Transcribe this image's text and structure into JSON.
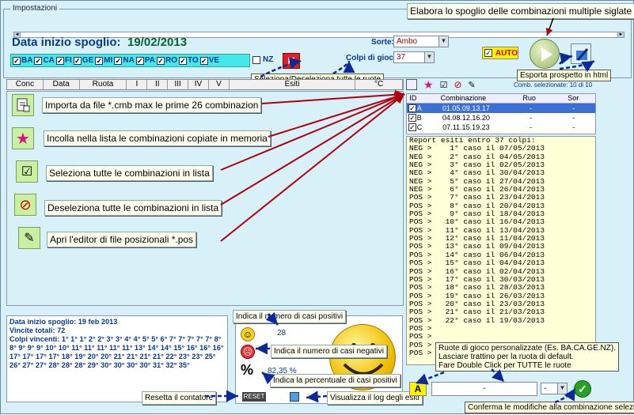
{
  "header": {
    "group_title": "Impostazioni",
    "start_label": "Data inizio spoglio:",
    "start_date": "19/02/2013",
    "sorte_label": "Sorte:",
    "sorte_value": "Ambo",
    "colpi_label": "Colpi di gioco:",
    "colpi_value": "37",
    "auto_label": "AUTO",
    "nz_label": "NZ",
    "n_button": "N"
  },
  "wheels": [
    "BA",
    "CA",
    "FI",
    "GE",
    "MI",
    "NA",
    "PA",
    "RO",
    "TO",
    "VE"
  ],
  "columns": [
    "Conc",
    "Data",
    "Ruota",
    "I",
    "II",
    "III",
    "IV",
    "V",
    "Esiti",
    "°C"
  ],
  "combo_table": {
    "headers": [
      "ID",
      "Combinazione",
      "Ruo",
      "Sor"
    ],
    "count_label": "Comb. selezionate: 10 di 10",
    "rows": [
      {
        "id": "A",
        "combo": "01.05.09.13.17",
        "ruo": "-",
        "sor": "-"
      },
      {
        "id": "B",
        "combo": "04.08.12.16.20",
        "ruo": "-",
        "sor": "-"
      },
      {
        "id": "C",
        "combo": "07.11.15.19.23",
        "ruo": "-",
        "sor": "-"
      }
    ]
  },
  "report": {
    "title": "Report esiti entro 37 colpi:",
    "lines": [
      "NEG >    1° caso il 07/05/2013",
      "NEG >    2° caso il 04/05/2013",
      "NEG >    3° caso il 02/05/2013",
      "NEG >    4° caso il 30/04/2013",
      "NEG >    5° caso il 27/04/2013",
      "NEG >    6° caso il 26/04/2013",
      "POS >    7° caso il 23/04/2013",
      "POS >    8° caso il 20/04/2013",
      "POS >    9° caso il 18/04/2013",
      "POS >   10° caso il 16/04/2013",
      "POS >   11° caso il 13/04/2013",
      "POS >   12° caso il 11/04/2013",
      "POS >   13° caso il 09/04/2013",
      "POS >   14° caso il 06/04/2013",
      "POS >   15° caso il 04/04/2013",
      "POS >   16° caso il 02/04/2013",
      "POS >   17° caso il 30/03/2013",
      "POS >   18° caso il 28/03/2013",
      "POS >   19° caso il 26/03/2013",
      "POS >   20° caso il 23/03/2013",
      "POS >   21° caso il 21/03/2013",
      "POS >   22° caso il 19/03/2013",
      "POS >",
      "POS >",
      "POS >",
      "POS >"
    ]
  },
  "stats": {
    "line1": "Data inizio spoglio: 19 feb 2013",
    "line2": "Vincite totali: 72",
    "line3": "Colpi vincenti: 1° 1° 1° 2° 2° 3° 3° 4° 4° 5° 5° 6° 7° 7° 7° 7° 7° 8° 8° 9° 9° 9° 10° 10° 11° 11° 11° 11° 11° 13° 14° 14° 15° 16° 16° 16° 17° 17° 17° 17° 18° 19° 20° 20° 21° 21° 21° 21° 22° 23° 23° 25° 26° 27° 27° 28° 28° 28° 29° 30° 30° 30° 30° 31° 32° 35°"
  },
  "info": {
    "positive_count": "28",
    "percent": "82,35 %",
    "reset_label": "RESET"
  },
  "callouts": {
    "top_multi": "Elabora lo spoglio delle combinazioni multiple siglate",
    "html_export": "Esporta prospetto in html",
    "toggle_wheels": "Seleziona/Deseleziona tutte le ruote",
    "import": "Importa da file *.cmb max le prime 26 combinazion",
    "paste": "Incolla nella lista le combinazioni copiate in memoria",
    "select_all": "Seleziona tutte le combinazioni in lista",
    "deselect_all": "Deseleziona tutte le combinazioni in lista",
    "editor": "Apri l'editor di file posizionali *.pos",
    "pos_count": "Indica il numero di casi positivi",
    "neg_count": "Indica il numero di casi negativi",
    "percent": "Indica la percentuale di casi positivi",
    "reset": "Resetta il contatore",
    "log": "Visualizza il log degli esiti",
    "custom_wheels": "Ruote di gioco personalizzate (Es. BA.CA.GE.NZ).",
    "default_dash": "Lasciare trattino per la ruota di default.",
    "double_click": "Fare Double Click per TUTTE le ruote",
    "confirm": "Conferma le modifiche alla combinazione selezionat"
  },
  "bottom": {
    "letter": "A",
    "field_value": "-",
    "select_value": "-"
  },
  "colors": {
    "accent": "#0a3a8a",
    "wheel_bar": "#44e8e8",
    "arrow_red": "#b00010",
    "arrow_blue": "#0a2a9a"
  }
}
